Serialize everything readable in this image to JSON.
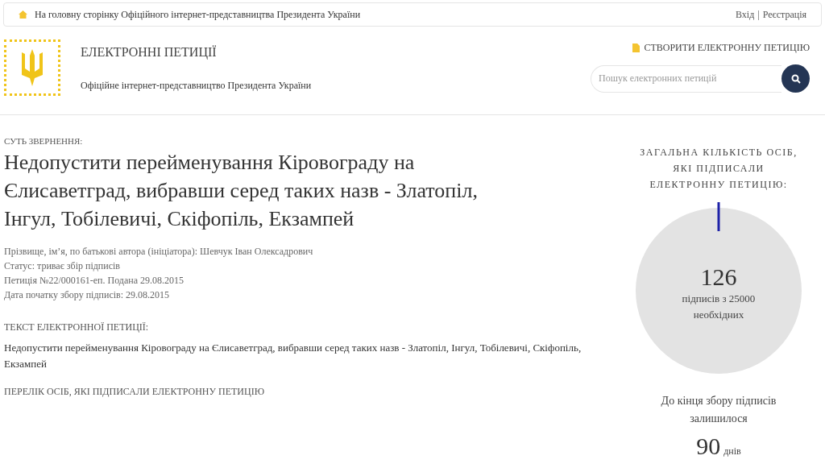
{
  "top_bar": {
    "home_link": "На головну сторінку Офіційного інтернет-представництва Президента України",
    "login": "Вхід",
    "separator": "|",
    "register": "Реєстрація"
  },
  "header": {
    "title": "ЕЛЕКТРОННІ ПЕТИЦІЇ",
    "subtitle": "Офіційне інтернет-представництво Президента України",
    "create_link": "СТВОРИТИ ЕЛЕКТРОННУ ПЕТИЦІЮ",
    "search": {
      "placeholder": "Пошук електронних петицій"
    }
  },
  "petition": {
    "subject_label": "СУТЬ ЗВЕРНЕННЯ:",
    "title": "Недопустити перейменування Кіровограду на Єлисаветград, вибравши серед таких назв - Златопіл, Інгул, Тобілевичі, Скіфопіль, Екзампей",
    "meta": [
      "Прізвище, ім’я, по батькові автора (ініціатора): Шевчук Іван Олексадрович",
      "Статус: триває збір підписів",
      "Петиція №22/000161-еп. Подана 29.08.2015",
      "Дата початку збору підписів: 29.08.2015"
    ],
    "text_label": "ТЕКСТ ЕЛЕКТРОННОЇ ПЕТИЦІЇ:",
    "text": "Недопустити перейменування Кіровограду на Єлисаветград, вибравши серед таких назв - Златопіл, Інгул, Тобілевичі, Скіфопіль, Екзампей",
    "signers_link": "ПЕРЕЛІК ОСІБ, ЯКІ ПІДПИСАЛИ ЕЛЕКТРОННУ ПЕТИЦІЮ"
  },
  "stats": {
    "heading": "ЗАГАЛЬНА КІЛЬКІСТЬ ОСІБ, ЯКІ ПІДПИСАЛИ ЕЛЕКТРОННУ ПЕТИЦІЮ:",
    "count": "126",
    "count_caption": "підписів з 25000 необхідних",
    "remaining_label": "До кінця збору підписів залишилося",
    "days": "90",
    "days_unit": "днів"
  }
}
